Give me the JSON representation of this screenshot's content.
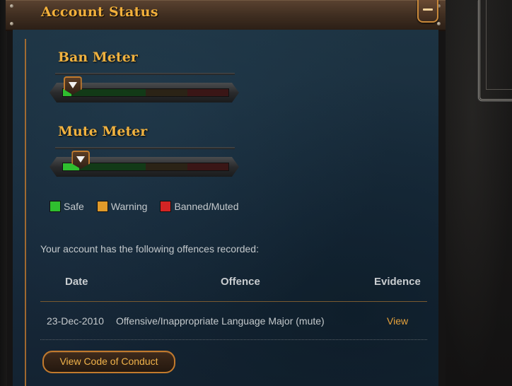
{
  "header": {
    "title": "Account Status"
  },
  "meters": {
    "ban": {
      "label": "Ban Meter",
      "level": 0.05
    },
    "mute": {
      "label": "Mute Meter",
      "level": 0.1
    }
  },
  "legend": [
    {
      "label": "Safe",
      "color": "#2fbf2f"
    },
    {
      "label": "Warning",
      "color": "#e09a2a"
    },
    {
      "label": "Banned/Muted",
      "color": "#d42424"
    }
  ],
  "offences": {
    "intro": "Your account has the following offences recorded:",
    "columns": {
      "date": "Date",
      "offence": "Offence",
      "evidence": "Evidence"
    },
    "rows": [
      {
        "date": "23-Dec-2010",
        "offence": "Offensive/Inappropriate Language Major (mute)",
        "evidence": "View"
      }
    ]
  },
  "buttons": {
    "code_of_conduct": "View Code of Conduct"
  }
}
